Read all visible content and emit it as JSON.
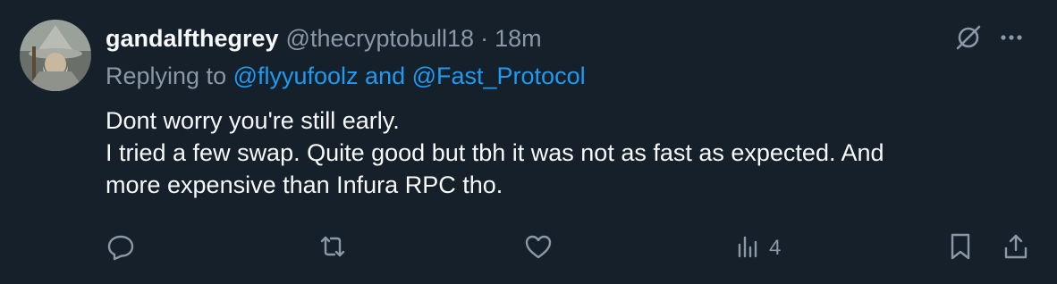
{
  "tweet": {
    "display_name": "gandalfthegrey",
    "handle": "@thecryptobull18",
    "separator": "·",
    "time": "18m",
    "replying_prefix": "Replying to ",
    "replying_mentions": "@flyyufoolz and @Fast_Protocol",
    "body_lines": [
      "Dont worry you're still early.",
      "I tried a few swap. Quite good but tbh it was not as fast as expected. And",
      "more expensive than Infura RPC tho."
    ],
    "views_count": "4"
  },
  "icons": {
    "top": [
      "grok-icon",
      "more-options-icon"
    ],
    "actions": [
      "reply-icon",
      "retweet-icon",
      "like-icon",
      "views-icon",
      "bookmark-icon",
      "share-icon"
    ]
  },
  "colors": {
    "background": "#15202b",
    "text_primary": "#f7f9f9",
    "text_secondary": "#8b98a5",
    "accent": "#1d9bf0"
  }
}
